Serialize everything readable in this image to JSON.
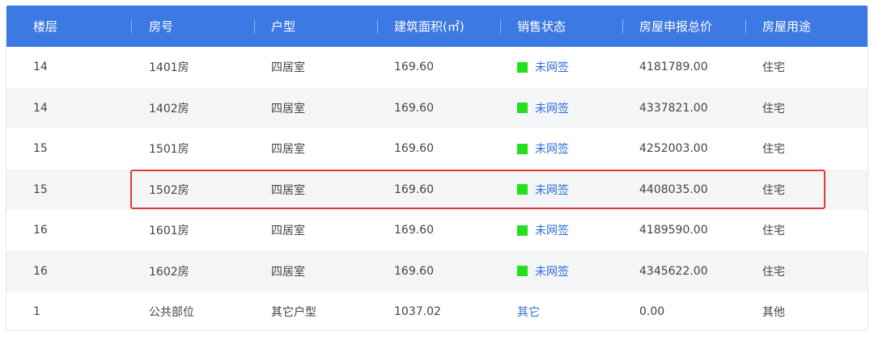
{
  "table": {
    "headers": [
      "楼层",
      "房号",
      "户型",
      "建筑面积(㎡)",
      "销售状态",
      "房屋申报总价",
      "房屋用途"
    ],
    "rows": [
      {
        "floor": "14",
        "room": "1401房",
        "type": "四居室",
        "area": "169.60",
        "status": "未网签",
        "status_marker": true,
        "price": "4181789.00",
        "use": "住宅"
      },
      {
        "floor": "14",
        "room": "1402房",
        "type": "四居室",
        "area": "169.60",
        "status": "未网签",
        "status_marker": true,
        "price": "4337821.00",
        "use": "住宅"
      },
      {
        "floor": "15",
        "room": "1501房",
        "type": "四居室",
        "area": "169.60",
        "status": "未网签",
        "status_marker": true,
        "price": "4252003.00",
        "use": "住宅"
      },
      {
        "floor": "15",
        "room": "1502房",
        "type": "四居室",
        "area": "169.60",
        "status": "未网签",
        "status_marker": true,
        "price": "4408035.00",
        "use": "住宅",
        "highlighted": true
      },
      {
        "floor": "16",
        "room": "1601房",
        "type": "四居室",
        "area": "169.60",
        "status": "未网签",
        "status_marker": true,
        "price": "4189590.00",
        "use": "住宅"
      },
      {
        "floor": "16",
        "room": "1602房",
        "type": "四居室",
        "area": "169.60",
        "status": "未网签",
        "status_marker": true,
        "price": "4345622.00",
        "use": "住宅"
      },
      {
        "floor": "1",
        "room": "公共部位",
        "type": "其它户型",
        "area": "1037.02",
        "status": "其它",
        "status_marker": false,
        "price": "0.00",
        "use": "其他"
      }
    ]
  },
  "colors": {
    "header_bg": "#3d79e3",
    "stripe_bg": "#f4f5f7",
    "status_text": "#2f6fd8",
    "status_marker": "#22e01b",
    "highlight_border": "#e53935"
  }
}
